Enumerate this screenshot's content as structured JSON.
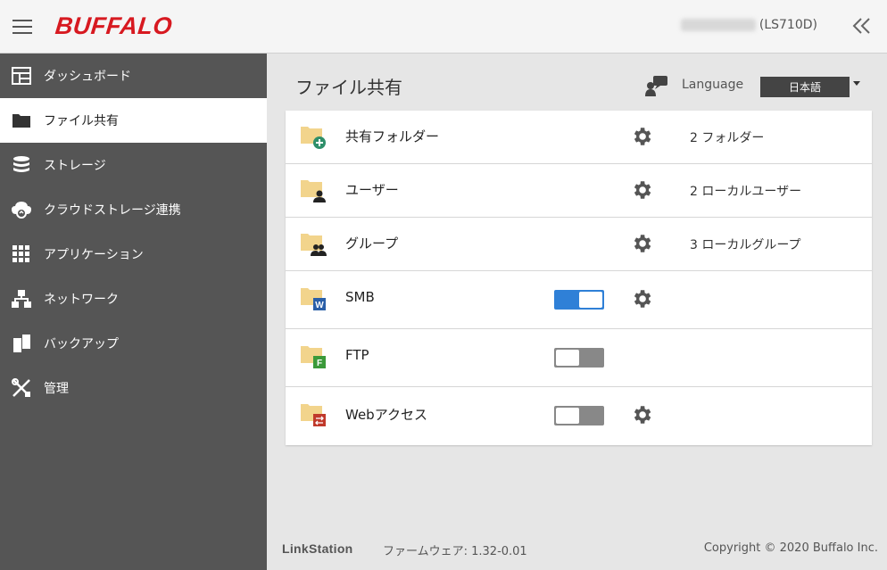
{
  "header": {
    "brand": "BUFFALO",
    "device_model": "(LS710D)"
  },
  "sidebar": {
    "items": [
      {
        "label": "ダッシュボード",
        "icon": "dashboard-icon"
      },
      {
        "label": "ファイル共有",
        "icon": "folder-icon",
        "active": true
      },
      {
        "label": "ストレージ",
        "icon": "storage-icon"
      },
      {
        "label": "クラウドストレージ連携",
        "icon": "cloud-sync-icon"
      },
      {
        "label": "アプリケーション",
        "icon": "apps-grid-icon"
      },
      {
        "label": "ネットワーク",
        "icon": "network-icon"
      },
      {
        "label": "バックアップ",
        "icon": "backup-icon"
      },
      {
        "label": "管理",
        "icon": "tools-icon"
      }
    ]
  },
  "main": {
    "title": "ファイル共有",
    "language_label": "Language",
    "language_value": "日本語",
    "rows": [
      {
        "label": "共有フォルダー",
        "summary": "2 フォルダー",
        "has_gear": true,
        "icon": "shared-folder-add-icon"
      },
      {
        "label": "ユーザー",
        "summary": "2 ローカルユーザー",
        "has_gear": true,
        "icon": "user-folder-icon"
      },
      {
        "label": "グループ",
        "summary": "3 ローカルグループ",
        "has_gear": true,
        "icon": "group-folder-icon"
      },
      {
        "label": "SMB",
        "toggle": true,
        "has_gear": true,
        "icon": "smb-folder-icon"
      },
      {
        "label": "FTP",
        "toggle": false,
        "has_gear": false,
        "icon": "ftp-folder-icon"
      },
      {
        "label": "Webアクセス",
        "toggle": false,
        "has_gear": true,
        "icon": "web-access-folder-icon"
      }
    ]
  },
  "footer": {
    "brand": "LinkStation",
    "firmware": "ファームウェア: 1.32-0.01",
    "copyright": "Copyright © 2020 Buffalo Inc."
  },
  "colors": {
    "brand_red": "#d71920",
    "sidebar_bg": "#555555",
    "toggle_on": "#2f80d7",
    "toggle_off": "#888888",
    "folder": "#f2d48c"
  }
}
